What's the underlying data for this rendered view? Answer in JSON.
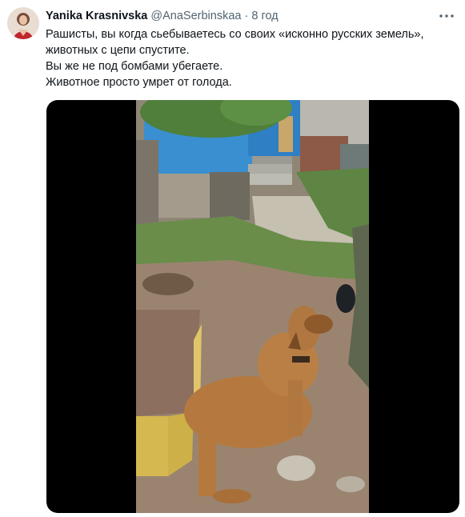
{
  "tweet": {
    "author": {
      "display_name": "Yanika Krasnivska",
      "handle": "@AnaSerbinskaa",
      "avatar": "avatar-photo"
    },
    "separator": "·",
    "timestamp": "8 год",
    "more_icon": "more-dots-icon",
    "text_lines": [
      "Рашисты, вы когда сьебываетесь со своих «исконно русских земель»,",
      "животных с цепи спустите.",
      "Вы же не под бомбами убегаете.",
      "Животное просто умрет от голода."
    ],
    "media": {
      "type": "video",
      "subject": "dog-on-chain-photo"
    }
  }
}
